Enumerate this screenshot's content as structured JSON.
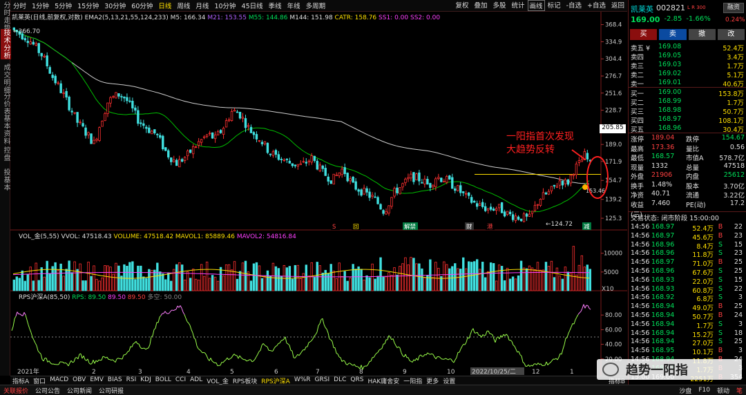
{
  "left_tabs": [
    "分时走势",
    "技术分析",
    "成交明细",
    "分价表",
    "基本资料",
    "控盘",
    "投基本"
  ],
  "toolbar": {
    "timeframes": [
      "分时",
      "1分钟",
      "5分钟",
      "15分钟",
      "30分钟",
      "60分钟",
      "日线",
      "周线",
      "月线",
      "10分钟",
      "45日线",
      "季线",
      "年线",
      "多周期"
    ],
    "active_timeframe": "日线",
    "right_items": [
      "复权",
      "叠加",
      "多股",
      "统计",
      "画线",
      "标记",
      "-自选",
      "+自选",
      "返回"
    ]
  },
  "chart_info": {
    "stock_label": "凯莱英(日线,前复权,对数)",
    "ema_label": "EMA2(5,13,21,55,124,233)",
    "m5": "M5: 166.34",
    "m21": "M21: 153.55",
    "m55": "M55: 144.86",
    "m144": "M144: 151.98",
    "catr": "CATR: 158.76",
    "ss1": "SS1: 0.00",
    "ss2": "SS2: 0.00",
    "high_label": "366.70",
    "low_label": "124.72",
    "low2_label": "153.46",
    "cursor_price": "205.85",
    "annotation_line1": "一阳指首次发现",
    "annotation_line2": "大趋势反转",
    "event_labels": [
      "S",
      "回",
      "解禁",
      "财",
      "港",
      "减"
    ],
    "price_ticks": [
      "368.4",
      "334.9",
      "304.4",
      "276.7",
      "251.6",
      "228.7",
      "208.0",
      "189.0",
      "171.9",
      "154.7",
      "139.2",
      "125.3"
    ],
    "volume_label": "VOL_金(5,55)",
    "vvol": "VVOL: 47518.43",
    "volume_value": "VOLUME: 47518.42",
    "mavol1": "MAVOL1: 85889.46",
    "mavol2": "MAVOL2: 54816.84",
    "vol_ticks": [
      "10000",
      "5000"
    ],
    "vol_unit": "X10",
    "rps_label": "RPS沪深A(85,50)",
    "rps1": "RPS: 89.50",
    "rps2": "89.50",
    "rps3": "89.50",
    "rps4": "多空: 50.00",
    "rps_ticks": [
      "80.00",
      "60.00",
      "40.00",
      "20.00"
    ],
    "x_labels": [
      "2021年",
      "2",
      "3",
      "4",
      "5",
      "6",
      "7",
      "8",
      "9",
      "10",
      "2022/10/25/二",
      "12",
      "1"
    ],
    "colors": {
      "up": "#ff3030",
      "down": "#40e0e0",
      "ma_green": "#00c000",
      "ma_white": "#cfcfcf",
      "annotation": "#ff2020",
      "rps": "#9aff4a",
      "rps_high": "#ff80ff"
    }
  },
  "indicator_bar": [
    "指标A",
    "窗口",
    "MACD",
    "OBV",
    "EMV",
    "BIAS",
    "RSI",
    "KDJ",
    "BOLL",
    "CCI",
    "ADL",
    "VOL_金",
    "RPS板块",
    "RPS沪深A",
    "W%R",
    "GRSI",
    "DLC",
    "QRS",
    "HAK庸舍安",
    "一阳指",
    "更多",
    "设置"
  ],
  "active_indicator": "RPS沪深A",
  "ind_right": "指标B",
  "status_bar": [
    "关联报价",
    "公司公告",
    "公司新闻",
    "公司研报"
  ],
  "status_right": [
    "沙盘",
    "F10",
    "顿动"
  ],
  "panel": {
    "name": "凯莱英",
    "code": "002821",
    "flags": "L R 300",
    "margin_btn": "融资",
    "price": "169.00",
    "change": "-2.85",
    "pct": "-1.66%",
    "ratio": "0.24%",
    "buttons": [
      "买",
      "卖",
      "撤",
      "改"
    ],
    "sell": [
      [
        "卖五 ¥",
        "169.08",
        "52.4万"
      ],
      [
        "卖四",
        "169.05",
        "3.4万"
      ],
      [
        "卖三",
        "169.03",
        "1.7万"
      ],
      [
        "卖二",
        "169.02",
        "5.1万"
      ],
      [
        "卖一",
        "169.01",
        "40.6万"
      ]
    ],
    "buy": [
      [
        "买一",
        "169.00",
        "153.8万"
      ],
      [
        "买二",
        "168.99",
        "1.7万"
      ],
      [
        "买三",
        "168.98",
        "50.7万"
      ],
      [
        "买四",
        "168.97",
        "108.1万"
      ],
      [
        "买五",
        "168.96",
        "30.4万"
      ]
    ],
    "stats": [
      [
        "涨停",
        "189.04",
        "跌停",
        "154.67"
      ],
      [
        "最高",
        "173.36",
        "量比",
        "0.56"
      ],
      [
        "最低",
        "168.57",
        "市值A",
        "578.7亿"
      ],
      [
        "现量",
        "1332",
        "总量",
        "47518"
      ],
      [
        "外盘",
        "21906",
        "内盘",
        "25612"
      ],
      [
        "换手",
        "1.48%",
        "股本",
        "3.70亿"
      ],
      [
        "净资",
        "40.71",
        "流通",
        "3.22亿"
      ],
      [
        "收益(三)",
        "7.460",
        "PE(动)",
        "17.2"
      ]
    ],
    "trade_status": "交易状态: 闭市阶段 15:00:00",
    "ticks": [
      [
        "14:56",
        "168.97",
        "52.4万",
        "B",
        "22"
      ],
      [
        "14:56",
        "168.97",
        "45.6万",
        "B",
        "23"
      ],
      [
        "14:56",
        "168.96",
        "8.4万",
        "S",
        "15"
      ],
      [
        "14:56",
        "168.96",
        "11.8万",
        "S",
        "23"
      ],
      [
        "14:56",
        "168.97",
        "71.0万",
        "B",
        "25"
      ],
      [
        "14:56",
        "168.96",
        "67.6万",
        "S",
        "25"
      ],
      [
        "14:56",
        "168.93",
        "22.0万",
        "S",
        "15"
      ],
      [
        "14:56",
        "168.93",
        "60.8万",
        "S",
        "22"
      ],
      [
        "14:56",
        "168.92",
        "6.8万",
        "S",
        "3"
      ],
      [
        "14:56",
        "168.94",
        "49.0万",
        "B",
        "25"
      ],
      [
        "14:56",
        "168.94",
        "50.7万",
        "B",
        "24"
      ],
      [
        "14:56",
        "168.94",
        "1.7万",
        "S",
        "3"
      ],
      [
        "14:56",
        "168.94",
        "15.2万",
        "S",
        "18"
      ],
      [
        "14:56",
        "168.94",
        "27.0万",
        "S",
        "25"
      ],
      [
        "14:56",
        "168.95",
        "10.1万",
        "B",
        "3"
      ],
      [
        "14:56",
        "168.94",
        "11.8万",
        "B",
        "24"
      ],
      [
        "14:57",
        "168.97",
        "1.7万",
        "B",
        "3"
      ],
      [
        "15:00",
        "169.00",
        "2251万",
        "B",
        "354"
      ]
    ],
    "bottom_tab": "笔"
  },
  "watermark": {
    "text": "趋势一阳指"
  }
}
